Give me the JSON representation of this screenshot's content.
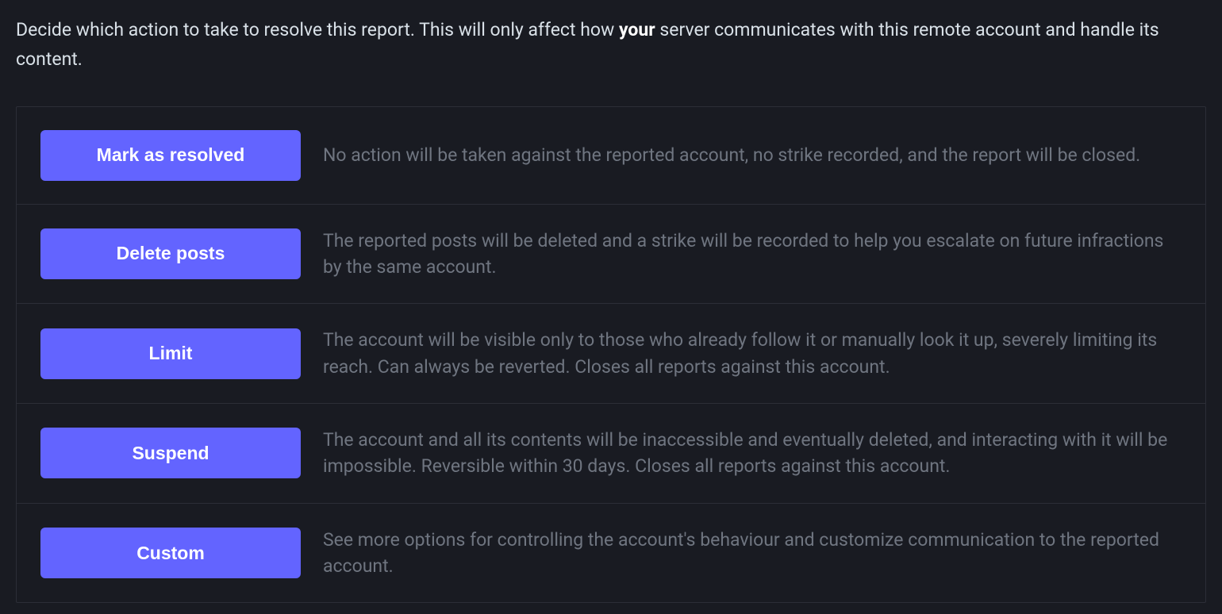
{
  "header": {
    "text_before": "Decide which action to take to resolve this report. This will only affect how ",
    "text_bold": "your",
    "text_after": " server communicates with this remote account and handle its content."
  },
  "actions": [
    {
      "label": "Mark as resolved",
      "description": "No action will be taken against the reported account, no strike recorded, and the report will be closed."
    },
    {
      "label": "Delete posts",
      "description": "The reported posts will be deleted and a strike will be recorded to help you escalate on future infractions by the same account."
    },
    {
      "label": "Limit",
      "description": "The account will be visible only to those who already follow it or manually look it up, severely limiting its reach. Can always be reverted. Closes all reports against this account."
    },
    {
      "label": "Suspend",
      "description": "The account and all its contents will be inaccessible and eventually deleted, and interacting with it will be impossible. Reversible within 30 days. Closes all reports against this account."
    },
    {
      "label": "Custom",
      "description": "See more options for controlling the account's behaviour and customize communication to the reported account."
    }
  ]
}
